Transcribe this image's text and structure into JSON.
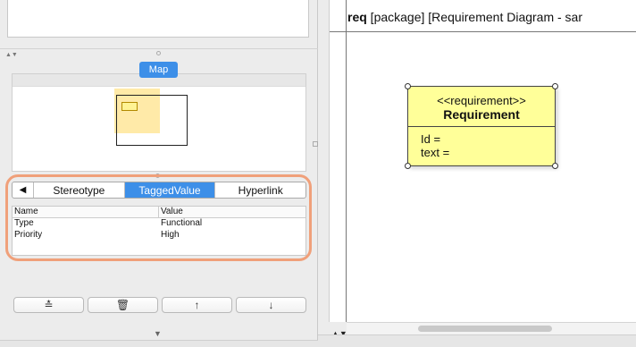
{
  "map": {
    "button_label": "Map"
  },
  "tabs": {
    "scroll_left_glyph": "◀",
    "items": [
      {
        "label": "Stereotype",
        "active": false
      },
      {
        "label": "TaggedValue",
        "active": true
      },
      {
        "label": "Hyperlink",
        "active": false
      }
    ]
  },
  "tagged_values": {
    "columns": [
      "Name",
      "Value"
    ],
    "rows": [
      {
        "name": "Type",
        "value": "Functional"
      },
      {
        "name": "Priority",
        "value": "High"
      }
    ]
  },
  "toolbar": {
    "add_glyph": "≛",
    "delete_glyph": "🗑",
    "up_glyph": "↑",
    "down_glyph": "↓"
  },
  "diagram": {
    "title_keyword": "req",
    "title_rest": " [package] [Requirement Diagram - sar",
    "element": {
      "stereotype": "<<requirement>>",
      "name": "Requirement",
      "attributes": [
        "Id =",
        "text ="
      ]
    }
  },
  "colors": {
    "accent": "#3d8fe8",
    "highlight_outline": "#f0a07a",
    "requirement_fill": "#ffff99"
  },
  "icons": {
    "scroll_updown": "▲▼",
    "chevron_down": "▼"
  }
}
